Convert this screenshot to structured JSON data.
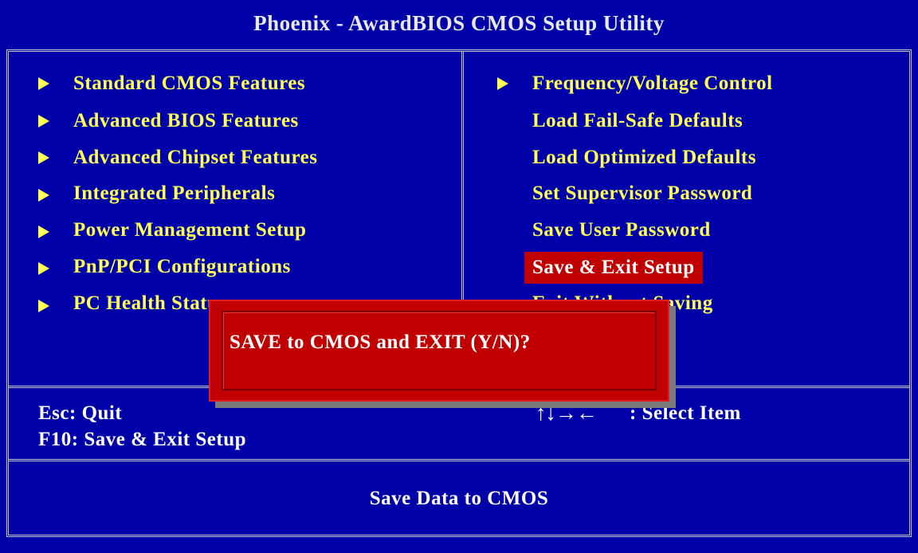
{
  "window": {
    "title": "Phoenix - AwardBIOS CMOS Setup Utility"
  },
  "colors": {
    "background": "#0000a8",
    "menu_text": "#ffff54",
    "highlight": "#c00000",
    "frame": "#c8c8c8",
    "white_text": "#ffffff"
  },
  "left_menu": [
    {
      "label": "Standard CMOS Features",
      "has_submenu": true
    },
    {
      "label": "Advanced BIOS Features",
      "has_submenu": true
    },
    {
      "label": "Advanced Chipset Features",
      "has_submenu": true
    },
    {
      "label": "Integrated Peripherals",
      "has_submenu": true
    },
    {
      "label": "Power Management Setup",
      "has_submenu": true
    },
    {
      "label": "PnP/PCI Configurations",
      "has_submenu": true
    },
    {
      "label": "PC Health Status",
      "has_submenu": true,
      "partially_hidden": true
    }
  ],
  "right_menu": [
    {
      "label": "Frequency/Voltage Control",
      "has_submenu": true
    },
    {
      "label": "Load Fail-Safe Defaults",
      "has_submenu": false
    },
    {
      "label": "Load Optimized Defaults",
      "has_submenu": false
    },
    {
      "label": "Set Supervisor Password",
      "has_submenu": false
    },
    {
      "label": "Save User Password",
      "has_submenu": false
    },
    {
      "label": "Save & Exit Setup",
      "has_submenu": false,
      "selected": true
    },
    {
      "label": "Exit Without Saving",
      "has_submenu": false,
      "partially_hidden": true
    }
  ],
  "key_hints": {
    "esc": "Esc: Quit",
    "f10": "F10: Save & Exit Setup",
    "arrows": "↑↓→←",
    "select": ": Select Item"
  },
  "dialog": {
    "prompt": "SAVE to CMOS and EXIT (Y/N)?"
  },
  "status_bar": {
    "text": "Save Data to CMOS"
  }
}
